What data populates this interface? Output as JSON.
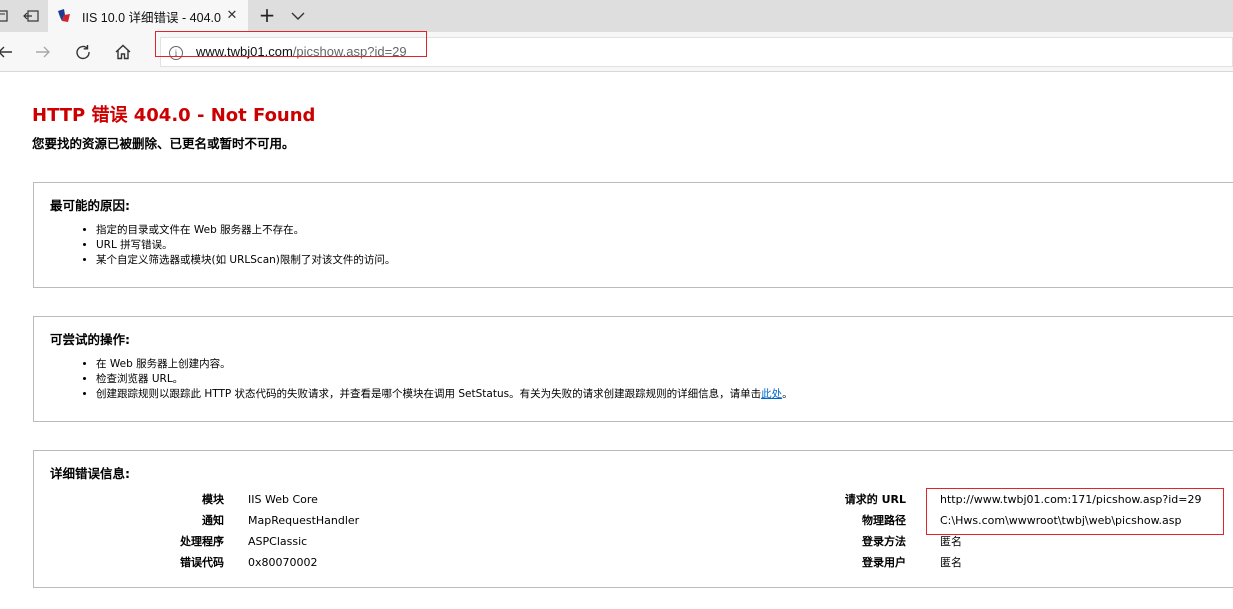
{
  "browser": {
    "tab": {
      "title": "IIS 10.0 详细错误 - 404.0"
    },
    "address": {
      "host": "www.twbj01.com",
      "path": "/picshow.asp?id=29"
    }
  },
  "page": {
    "title": "HTTP 错误 404.0 - Not Found",
    "subtitle": "您要找的资源已被删除、已更名或暂时不可用。",
    "causes": {
      "heading": "最可能的原因:",
      "items": [
        "指定的目录或文件在 Web 服务器上不存在。",
        "URL 拼写错误。",
        "某个自定义筛选器或模块(如 URLScan)限制了对该文件的访问。"
      ]
    },
    "actions": {
      "heading": "可尝试的操作:",
      "items": [
        "在 Web 服务器上创建内容。",
        "检查浏览器 URL。"
      ],
      "trace_text": "创建跟踪规则以跟踪此 HTTP 状态代码的失败请求，并查看是哪个模块在调用 SetStatus。有关为失败的请求创建跟踪规则的详细信息，请单击",
      "trace_link": "此处",
      "trace_end": "。"
    },
    "details": {
      "heading": "详细错误信息:",
      "left": [
        {
          "label": "模块",
          "value": "IIS Web Core"
        },
        {
          "label": "通知",
          "value": "MapRequestHandler"
        },
        {
          "label": "处理程序",
          "value": "ASPClassic"
        },
        {
          "label": "错误代码",
          "value": "0x80070002"
        }
      ],
      "right": [
        {
          "label": "请求的 URL",
          "value": "http://www.twbj01.com:171/picshow.asp?id=29"
        },
        {
          "label": "物理路径",
          "value": "C:\\Hws.com\\wwwroot\\twbj\\web\\picshow.asp"
        },
        {
          "label": "登录方法",
          "value": "匿名"
        },
        {
          "label": "登录用户",
          "value": "匿名"
        }
      ]
    }
  },
  "colors": {
    "title_red": "#cc0000",
    "highlight": "#e0242b",
    "link": "#0066cc"
  }
}
